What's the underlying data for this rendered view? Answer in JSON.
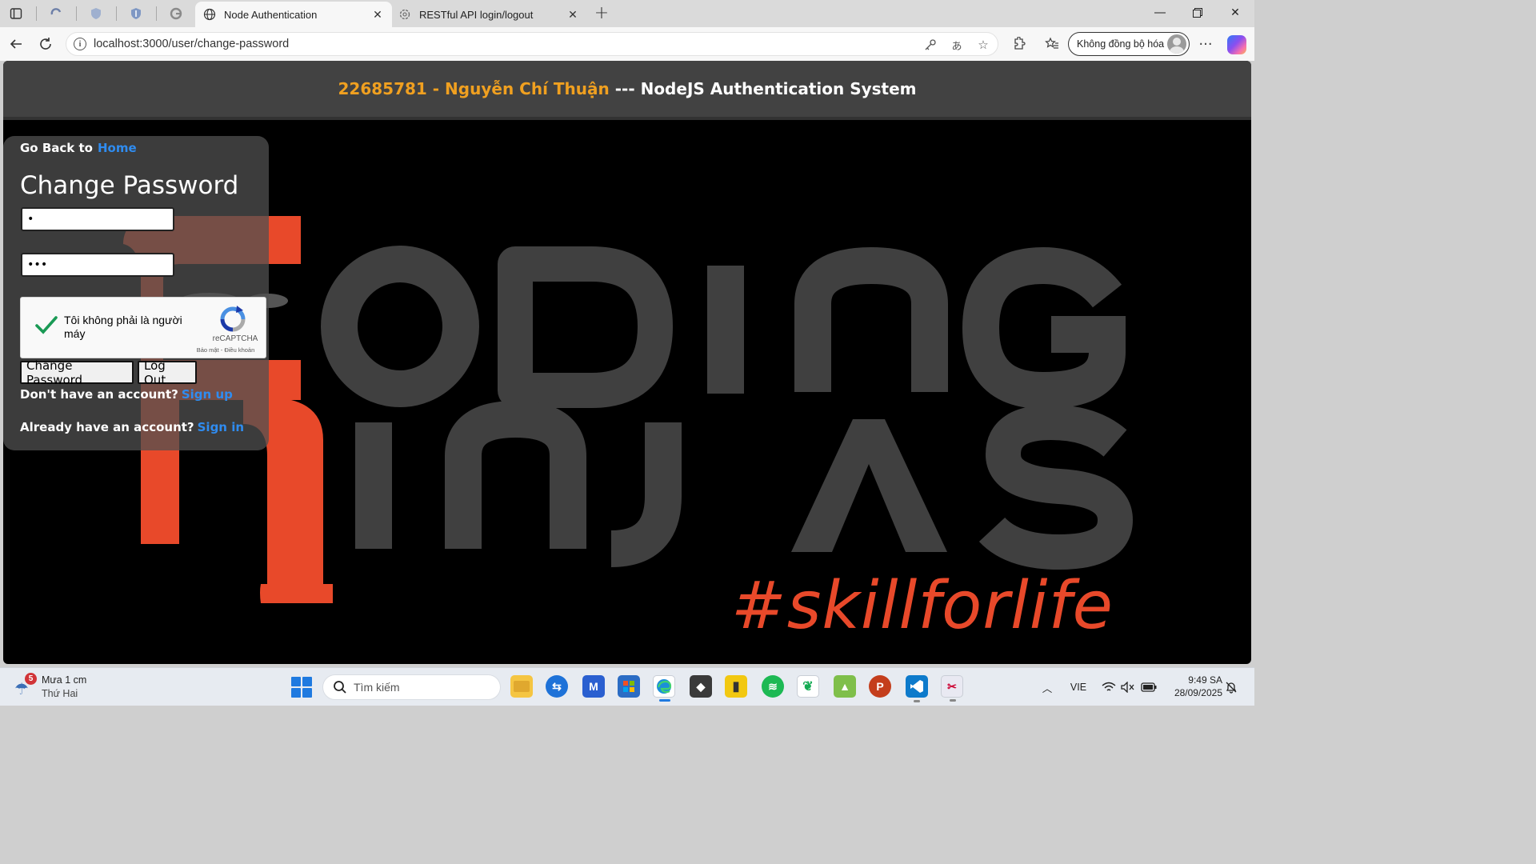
{
  "browser": {
    "tabs": [
      {
        "title": "Node Authentication",
        "active": true,
        "icon": "globe-icon"
      },
      {
        "title": "RESTful API login/logout",
        "active": false,
        "icon": "openai-icon"
      }
    ],
    "address": {
      "url": "localhost:3000/user/change-password"
    },
    "sync_label": "Không đồng bộ hóa"
  },
  "page": {
    "header": {
      "student": "22685781 - Nguyễn Chí Thuận",
      "separator": " --- ",
      "system": "NodeJS Authentication System"
    },
    "background": {
      "line1": "CODING",
      "line2": "NINJAS",
      "tagline": "#skillforlife"
    },
    "form": {
      "goback_label": "Go Back to",
      "goback_link": "Home",
      "title": "Change Password",
      "password1_value": "•",
      "password2_value": "•••",
      "recaptcha": {
        "label": "Tôi không phải là người máy",
        "brand": "reCAPTCHA",
        "terms": "Bảo mật - Điều khoản",
        "checked": true
      },
      "submit_label": "Change Password",
      "logout_label": "Log Out",
      "signup_prompt": "Don't have an account?",
      "signup_link": "Sign up",
      "signin_prompt": "Already have an account?",
      "signin_link": "Sign in"
    }
  },
  "taskbar": {
    "weather": {
      "badge": "5",
      "line1": "Mưa 1 cm",
      "line2": "Thứ Hai"
    },
    "search_placeholder": "Tìm kiếm",
    "language": "VIE",
    "time": "9:49 SA",
    "date": "28/09/2025",
    "colors": {
      "accent": "#1f7ae0",
      "brand_orange": "#e8492a",
      "header_accent": "#f0a020"
    }
  }
}
